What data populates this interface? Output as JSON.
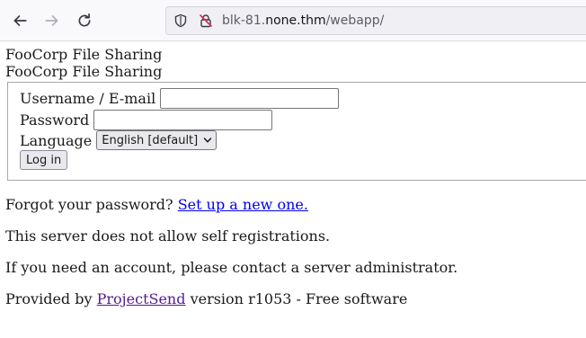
{
  "browser": {
    "url_host_prefix": "blk-81.",
    "url_host_domain": "none.thm",
    "url_path": "/webapp/"
  },
  "page": {
    "heading_1": "FooCorp File Sharing",
    "heading_2": "FooCorp File Sharing"
  },
  "form": {
    "username_label": "Username / E-mail",
    "username_value": "",
    "password_label": "Password",
    "password_value": "",
    "language_label": "Language",
    "language_selected": "English [default]",
    "login_button": "Log in"
  },
  "links": {
    "forgot_prefix": "Forgot your password?",
    "forgot_link": "Set up a new one.",
    "no_registration": "This server does not allow self registrations.",
    "contact_admin": "If you need an account, please contact a server administrator.",
    "provided_prefix": "Provided by",
    "provided_link": "ProjectSend",
    "provided_suffix": "version r1053 - Free software"
  },
  "colors": {
    "link": "#0000ee",
    "visited_link": "#551a8b"
  }
}
